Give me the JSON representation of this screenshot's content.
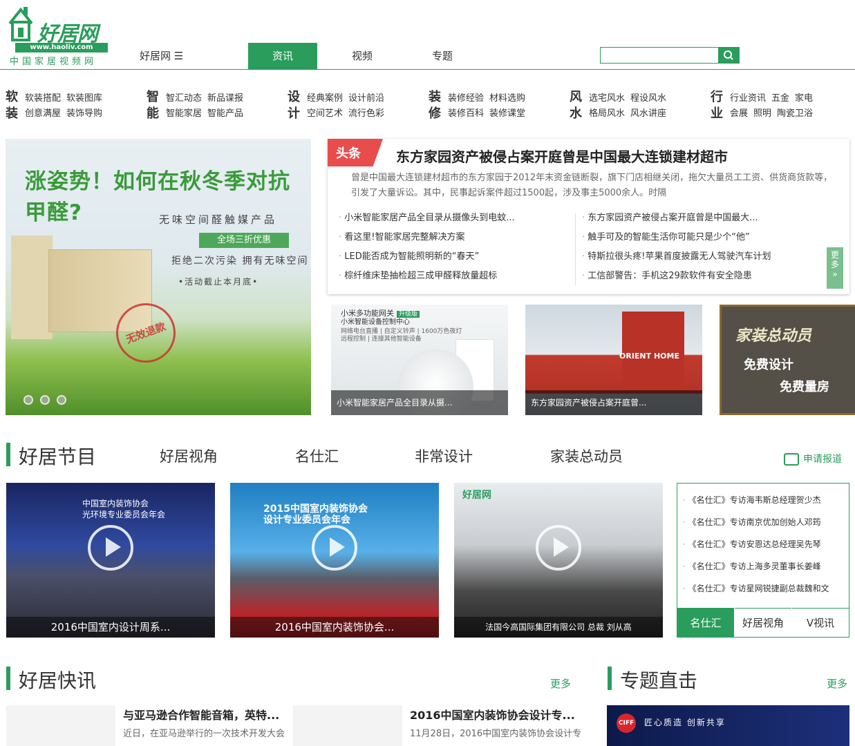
{
  "logo": {
    "name": "好居网",
    "url": "www.haoliv.com",
    "tagline": "中国家居视频网"
  },
  "site_menu": {
    "label": "好居网 ☰"
  },
  "nav": [
    {
      "label": "资讯",
      "active": true
    },
    {
      "label": "视频",
      "active": false
    },
    {
      "label": "专题",
      "active": false
    }
  ],
  "search": {
    "placeholder": ""
  },
  "categories": [
    {
      "head": [
        "软",
        "装"
      ],
      "links": [
        [
          "软装搭配",
          "软装图库"
        ],
        [
          "创意满屋",
          "装饰导购"
        ]
      ]
    },
    {
      "head": [
        "智",
        "能"
      ],
      "links": [
        [
          "智汇动态",
          "新品谍报"
        ],
        [
          "智能家居",
          "智能产品"
        ]
      ]
    },
    {
      "head": [
        "设",
        "计"
      ],
      "links": [
        [
          "经典案例",
          "设计前沿"
        ],
        [
          "空间艺术",
          "流行色彩"
        ]
      ]
    },
    {
      "head": [
        "装",
        "修"
      ],
      "links": [
        [
          "装修经验",
          "材料选购"
        ],
        [
          "装修百科",
          "装修课堂"
        ]
      ]
    },
    {
      "head": [
        "风",
        "水"
      ],
      "links": [
        [
          "选宅风水",
          "程设风水"
        ],
        [
          "格局风水",
          "风水讲座"
        ]
      ]
    },
    {
      "head": [
        "行",
        "业"
      ],
      "links": [
        [
          "行业资讯",
          "五金",
          "家电"
        ],
        [
          "会展",
          "照明",
          "陶瓷卫浴"
        ]
      ]
    }
  ],
  "banner": {
    "headline": "涨姿势！如何在秋冬季对抗甲醛?",
    "line1": "无味空间醛触媒产品",
    "promo": "全场三折优惠",
    "line2": "拒绝二次污染  拥有无味空间",
    "line3": "•活动截止本月底•",
    "stamp": "无效退款"
  },
  "headline_news": {
    "tag": "头条",
    "title": "东方家园资产被侵占案开庭曾是中国最大连锁建材超市",
    "summary": "曾是中国最大连锁建材超市的东方家园于2012年末资金链断裂，旗下门店相继关闭，拖欠大量员工工资、供货商货款等，引发了大量诉讼。其中，民事起诉案件超过1500起，涉及事主5000余人。时隔",
    "left": [
      "小米智能家居产品全目录从摄像头到电蚊...",
      "看这里!智能家居完整解决方案",
      "LED能否成为智能照明新的“春天”",
      "棕纤维床垫抽检超三成甲醛释放量超标"
    ],
    "right": [
      "东方家园资产被侵占案开庭曾是中国最大...",
      "触手可及的智能生活你可能只是少个“他”",
      "特斯拉很头疼!苹果首度披露无人驾驶汽车计划",
      "工信部警告：手机这29款软件有安全隐患"
    ],
    "more": "更多"
  },
  "thumbs": {
    "t1": {
      "caption": "小米智能家居产品全目录从摄...",
      "title": "小米多功能网关",
      "badge": "升级版",
      "spec1": "小米智能设备控制中心",
      "spec2": "网络电台直播 | 自定义铃声 | 1600万色夜灯",
      "spec3": "远程控制 | 连接其他智能设备"
    },
    "t2": {
      "caption": "东方家园资产被侵占案开庭曾...",
      "sign": "ORIENT HOME"
    },
    "t3": {
      "l1": "家装总动员",
      "l2": "免费设计",
      "l3": "免费量房"
    }
  },
  "program": {
    "title": "好居节目",
    "tabs": [
      "好居视角",
      "名仕汇",
      "非常设计",
      "家装总动员"
    ],
    "apply": "申请报道"
  },
  "videos": [
    {
      "caption": "2016中国室内设计周系...",
      "slide": "中国室内装饰协会\n光环境专业委员会年会"
    },
    {
      "caption": "2016中国室内装饰协会...",
      "slide": "2015中国室内装饰协会\n设计专业委员会年会"
    },
    {
      "caption": "法国今高国际集团有限公司 总裁 刘从高",
      "slide": "好居网"
    }
  ],
  "side_list": {
    "items": [
      "《名仕汇》专访海韦斯总经理贺少杰",
      "《名仕汇》专访南京优加创始人邓筠",
      "《名仕汇》专访安恩达总经理吴先琴",
      "《名仕汇》专访上海多灵董事长姜峰",
      "《名仕汇》专访星网锐捷副总裁魏和文"
    ],
    "tabs": [
      {
        "label": "名仕汇",
        "active": true
      },
      {
        "label": "好居视角",
        "active": false
      },
      {
        "label": "V视讯",
        "active": false
      }
    ]
  },
  "news_section": {
    "title": "好居快讯",
    "more": "更多",
    "cards": [
      {
        "title": "与亚马逊合作智能音箱，英特...",
        "text": "近日，在亚马逊举行的一次技术开发大会"
      },
      {
        "title": "2016中国室内装饰协会设计专...",
        "text": "11月28日，2016中国室内装饰协会设计专"
      }
    ]
  },
  "topic_section": {
    "title": "专题直击",
    "more": "更多",
    "banner_logo": "CIFF",
    "banner_text": "匠心质造  创新共享"
  }
}
